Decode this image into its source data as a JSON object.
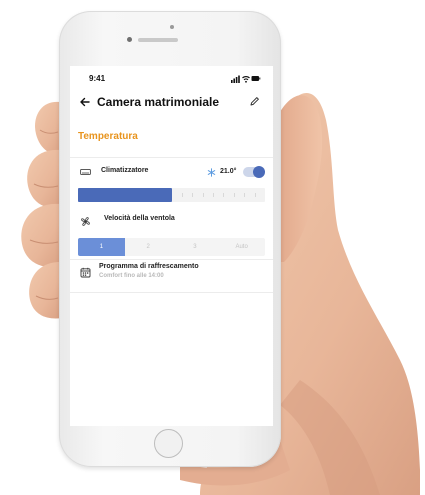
{
  "status_bar": {
    "time": "9:41",
    "icons": [
      "signal-icon",
      "wifi-icon",
      "battery-icon"
    ]
  },
  "header": {
    "back_icon": "arrow-left-icon",
    "title": "Camera matrimoniale",
    "edit_icon": "pencil-icon"
  },
  "section": {
    "title": "Temperatura"
  },
  "climate": {
    "icon": "air-conditioner-icon",
    "label": "Climatizzatore",
    "mode_icon": "snowflake-icon",
    "temperature": "21.0°",
    "enabled": true,
    "level_fraction": 0.5
  },
  "fan": {
    "icon": "fan-icon",
    "label": "Velocità della ventola",
    "options": [
      "1",
      "2",
      "3",
      "Auto"
    ],
    "selected": "1"
  },
  "schedule": {
    "icon": "calendar-icon",
    "title": "Programma di raffrescamento",
    "subtitle": "Comfort fino alle 14:00"
  },
  "colors": {
    "accent": "#e8941e",
    "primary": "#4a6ab8",
    "active_segment": "#6b8fd8"
  }
}
